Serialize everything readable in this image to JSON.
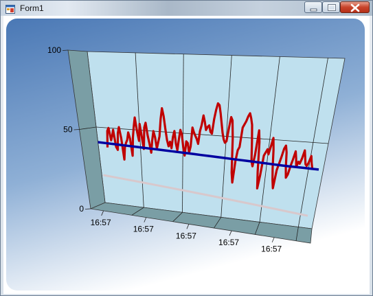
{
  "window": {
    "title": "Form1",
    "icon": "app-form-icon",
    "controls": [
      "minimize-icon",
      "maximize-icon",
      "close-icon"
    ]
  },
  "chart_data": {
    "type": "line",
    "view": "3d",
    "yticks": [
      "0",
      "50",
      "100"
    ],
    "ylim": [
      0,
      100
    ],
    "xticks": [
      "16:57",
      "16:57",
      "16:57",
      "16:57",
      "16:57"
    ],
    "grid": true,
    "colors": {
      "back_wall": "#bfe0ee",
      "side_wall": "#7a9ea5",
      "floor": "#7a9ea5",
      "background_top": "#4a78b5",
      "background_bottom": "#ffffff"
    },
    "series": [
      {
        "color": "#c00000",
        "values": [
          37,
          48,
          50,
          42,
          45,
          49,
          38,
          36,
          47,
          51,
          44,
          30,
          38,
          41,
          43,
          48,
          44,
          33,
          45,
          52,
          58,
          49,
          43,
          54,
          46,
          38,
          52,
          55,
          47,
          42,
          36,
          44,
          50,
          46,
          39,
          43,
          47,
          58,
          65,
          60,
          52,
          45,
          41,
          44,
          40,
          47,
          51,
          43,
          39,
          46,
          52,
          49,
          41,
          36,
          45,
          44,
          38,
          42,
          54,
          51,
          49,
          47,
          44,
          52,
          56,
          62,
          58,
          53,
          55,
          56,
          52,
          51,
          60,
          66,
          70,
          69,
          64,
          58,
          52,
          48,
          46,
          47,
          55,
          62,
          60,
          49,
          28,
          22,
          35,
          42,
          44,
          56,
          58,
          60,
          63,
          65,
          62,
          58,
          48,
          36,
          33,
          40,
          55,
          48,
          30,
          20,
          28,
          40,
          42,
          44,
          41,
          46,
          51,
          44,
          33,
          26,
          21,
          32,
          36,
          40,
          45,
          47,
          43,
          34,
          28,
          30,
          35,
          39,
          44,
          40,
          35,
          38,
          37,
          40,
          45,
          41,
          37,
          36,
          38,
          42,
          38,
          35
        ]
      },
      {
        "color": "#0000a0",
        "values": [
          40,
          39.8,
          39.6,
          39.4,
          39.2,
          39,
          38.8,
          38.6,
          38.4,
          38.2,
          38,
          37.8,
          37.6,
          37.4,
          37.2,
          37,
          36.8,
          36.6,
          36.4,
          36.2,
          36,
          35.8,
          35.6,
          35.4,
          35.2,
          35,
          34.9,
          34.8,
          34.7,
          34.6,
          34.5
        ]
      },
      {
        "color": "#d8c8cc",
        "values": [
          10,
          9.5,
          9,
          8.5,
          8,
          7.5,
          7,
          6.5,
          6,
          5.5,
          5,
          4.5,
          4,
          3.5,
          3,
          2.5,
          2,
          1.5,
          1,
          0.5,
          0
        ]
      }
    ]
  }
}
